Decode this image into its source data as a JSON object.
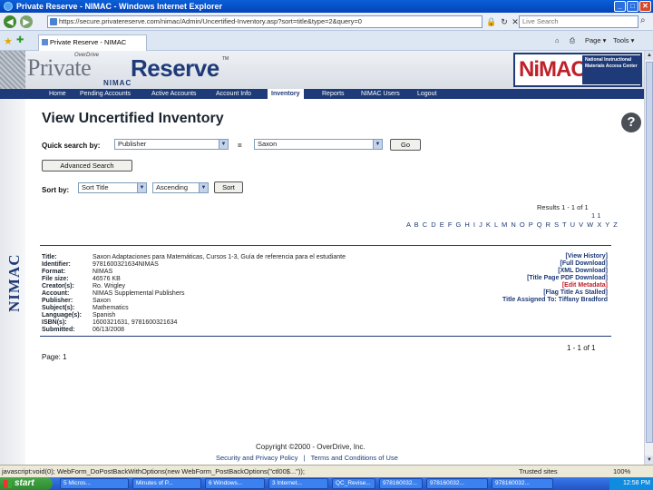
{
  "window": {
    "title": "Private Reserve - NIMAC - Windows Internet Explorer",
    "min": "_",
    "max": "□",
    "close": "✕"
  },
  "address": {
    "url": "https://secure.privatereserve.com/nimac/Admin/Uncertified-Inventory.asp?sort=title&type=2&query=0",
    "search_placeholder": "Live Search"
  },
  "tabs": {
    "active_label": "Private Reserve - NIMAC",
    "commands": [
      "Page ▾",
      "Tools ▾"
    ]
  },
  "site": {
    "brand_small": "OverDrive",
    "brand_private": "Private",
    "brand_reserve": "Reserve",
    "brand_tm": "TM",
    "brand_sub": "NIMAC",
    "badge_big": "NiMAC",
    "badge_text": "National Instructional Materials Access Center",
    "sidebar_vertical": "NIMAC"
  },
  "nav": {
    "items": [
      "Home",
      "Pending Accounts",
      "Active Accounts",
      "Account Info",
      "Inventory",
      "Reports",
      "NIMAC Users",
      "Logout"
    ],
    "active": "Inventory"
  },
  "page": {
    "title": "View Uncertified Inventory",
    "help": "?"
  },
  "quick_search": {
    "label": "Quick search by:",
    "field": "Publisher",
    "operator": "=",
    "value": "Saxon",
    "go": "Go",
    "advanced": "Advanced Search"
  },
  "sort": {
    "label": "Sort by:",
    "field": "Sort Title",
    "order": "Ascending",
    "button": "Sort"
  },
  "results": {
    "count_text": "Results 1 - 1 of 1",
    "pages": "1  1",
    "alphabet": "A B C D E F G H I J K L M N O P Q R S T U V W X Y Z",
    "bottom_count": "1 - 1 of 1",
    "page_label": "Page: 1"
  },
  "record": {
    "fields": [
      {
        "label": "Title:",
        "value": "Saxon Adaptaciones para Matemáticas, Cursos 1-3, Guía de referencia para el estudiante"
      },
      {
        "label": "Identifier:",
        "value": "9781600321634NIMAS"
      },
      {
        "label": "Format:",
        "value": "NIMAS"
      },
      {
        "label": "File size:",
        "value": "46576 KB"
      },
      {
        "label": "Creator(s):",
        "value": "Ro. Wrigley"
      },
      {
        "label": "Account:",
        "value": "NIMAS Supplemental Publishers"
      },
      {
        "label": "Publisher:",
        "value": "Saxon"
      },
      {
        "label": "Subject(s):",
        "value": "Mathematics"
      },
      {
        "label": "Language(s):",
        "value": "Spanish"
      },
      {
        "label": "ISBN(s):",
        "value": "1600321631, 9781600321634"
      },
      {
        "label": "Submitted:",
        "value": "06/13/2008"
      }
    ],
    "actions": [
      "[View History]",
      "[Full Download]",
      "[XML Download]",
      "[Title Page PDF Download]",
      "[Edit Metadata]",
      "[Flag Title As Stalled]"
    ],
    "assigned": "Title Assigned To: Tiffany Bradford"
  },
  "footer": {
    "copyright": "Copyright ©2000 - OverDrive, Inc.",
    "links": [
      "Security and Privacy Policy",
      "|",
      "Terms and Conditions of Use"
    ]
  },
  "status": {
    "text": "javascript:void(0); WebForm_DoPostBackWithOptions(new WebForm_PostBackOptions(\"ctl00$...\"));",
    "zone": "Trusted sites",
    "zoom": "100%"
  },
  "taskbar": {
    "start": "start",
    "items": [
      "5 Micros...",
      "Minutes of P...",
      "6 Windows...",
      "3 Internet...",
      "QC_Revise...",
      "978160032...",
      "978160032...",
      "978160032..."
    ],
    "clock": "12:58 PM"
  }
}
